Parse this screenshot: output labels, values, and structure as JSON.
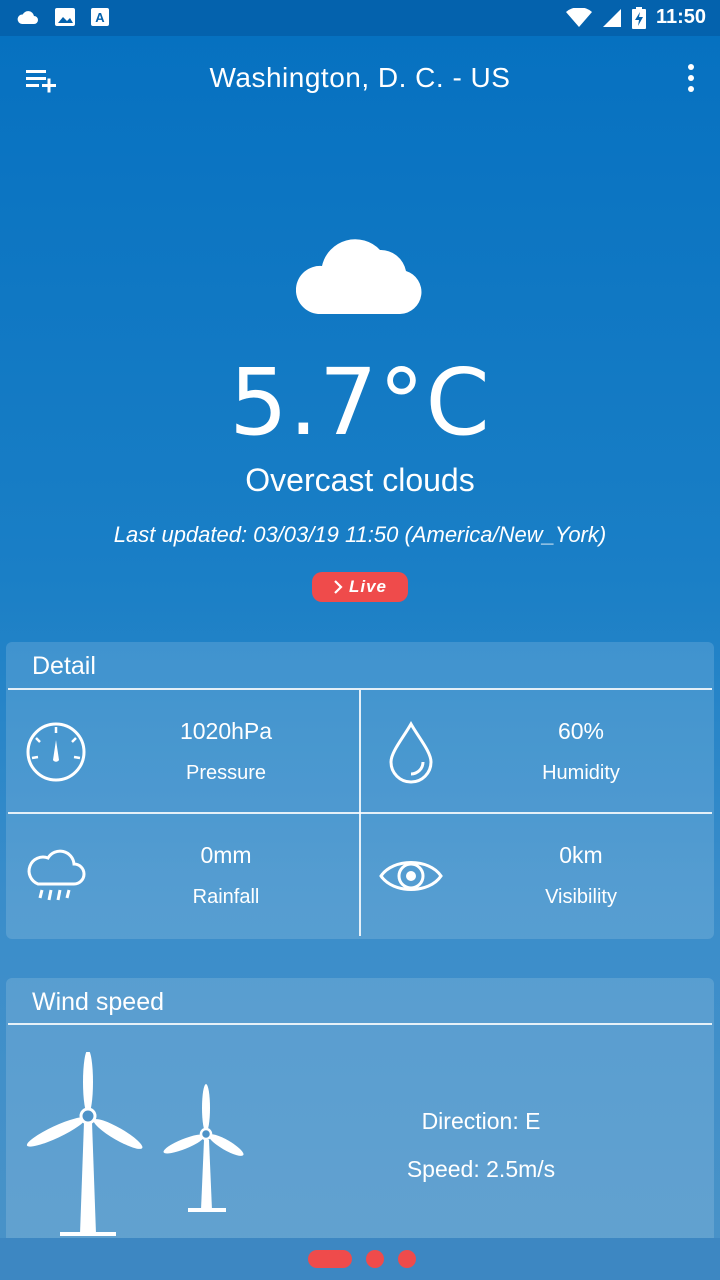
{
  "status_bar": {
    "time": "11:50",
    "left_icons": [
      "cloud-icon",
      "image-icon",
      "a-font-icon"
    ],
    "right_icons": [
      "wifi-icon",
      "signal-icon",
      "battery-charging-icon"
    ]
  },
  "app_bar": {
    "title": "Washington, D. C. - US",
    "left_icon": "playlist-add-icon",
    "right_icon": "more-vert-icon"
  },
  "current": {
    "icon": "cloud-icon",
    "temperature": "5.7°C",
    "condition": "Overcast clouds",
    "last_updated": "Last updated: 03/03/19 11:50 (America/New_York)",
    "live_label": "Live"
  },
  "detail": {
    "title": "Detail",
    "items": [
      {
        "icon": "gauge-icon",
        "value": "1020hPa",
        "label": "Pressure"
      },
      {
        "icon": "droplet-icon",
        "value": "60%",
        "label": "Humidity"
      },
      {
        "icon": "rain-cloud-icon",
        "value": "0mm",
        "label": "Rainfall"
      },
      {
        "icon": "eye-icon",
        "value": "0km",
        "label": "Visibility"
      }
    ]
  },
  "wind": {
    "title": "Wind speed",
    "direction": "Direction: E",
    "speed": "Speed: 2.5m/s"
  },
  "pager": {
    "pages": 3,
    "active_index": 0
  },
  "colors": {
    "accent": "#ef4b4b",
    "status_bar": "#0462ad",
    "background_top": "#0570c0",
    "background_bottom": "#4a93c8"
  }
}
